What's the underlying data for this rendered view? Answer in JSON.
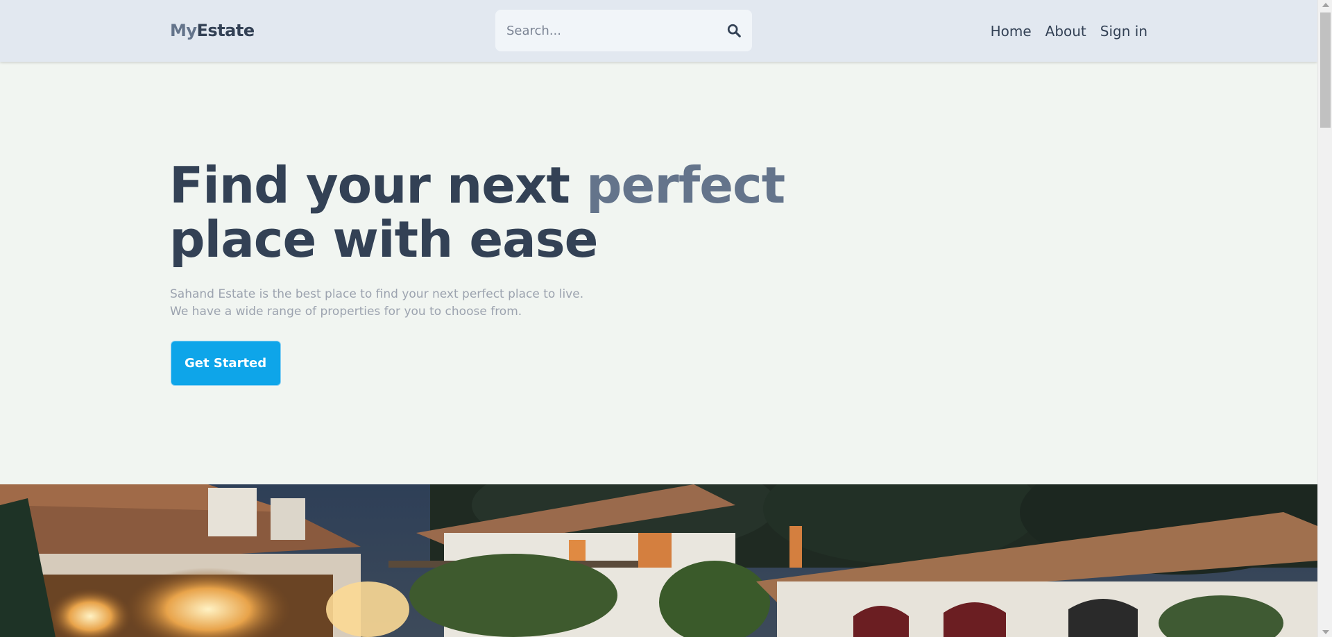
{
  "header": {
    "logo_part1": "My",
    "logo_part2": "Estate",
    "search_placeholder": "Search...",
    "nav": [
      "Home",
      "About",
      "Sign in"
    ]
  },
  "hero": {
    "title_part1": "Find your next ",
    "title_accent": "perfect",
    "title_part2": "place with ease",
    "subtitle_line1": "Sahand Estate is the best place to find your next perfect place to live.",
    "subtitle_line2": "We have a wide range of properties for you to choose from.",
    "cta_label": "Get Started"
  },
  "icons": {
    "search": "search-icon"
  },
  "colors": {
    "header_bg": "#e2e8f0",
    "page_bg": "#f1f5f1",
    "text_dark": "#334155",
    "text_muted": "#64748b",
    "accent_button": "#0ea5e9"
  }
}
